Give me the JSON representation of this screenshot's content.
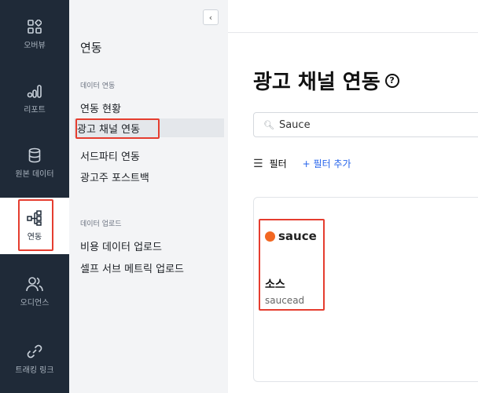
{
  "rail": [
    {
      "label": "오버뷰",
      "icon": "grid-icon"
    },
    {
      "label": "리포트",
      "icon": "bar-chart-icon"
    },
    {
      "label": "원본 데이터",
      "icon": "database-icon"
    },
    {
      "label": "연동",
      "icon": "hierarchy-icon"
    },
    {
      "label": "오디언스",
      "icon": "users-icon"
    },
    {
      "label": "트래킹 링크",
      "icon": "link-icon"
    }
  ],
  "sidebar": {
    "collapse_glyph": "‹",
    "title": "연동",
    "section1": "데이터 연동",
    "items1": [
      "연동 현황",
      "광고 채널 연동",
      "서드파티 연동",
      "광고주 포스트백"
    ],
    "section2": "데이터 업로드",
    "items2": [
      "비용 데이터 업로드",
      "셀프 서브 메트릭 업로드"
    ]
  },
  "main": {
    "title": "광고 채널 연동",
    "help": "?",
    "search_value": "Sauce",
    "filter_label": "필터",
    "add_filter_label": "+ 필터 추가",
    "card": {
      "logo_text": "sauce",
      "name": "소스",
      "sub": "saucead"
    }
  },
  "colors": {
    "rail_bg": "#1f2a38",
    "highlight": "#e53d2f",
    "link": "#2563eb",
    "brand": "#f26722"
  }
}
